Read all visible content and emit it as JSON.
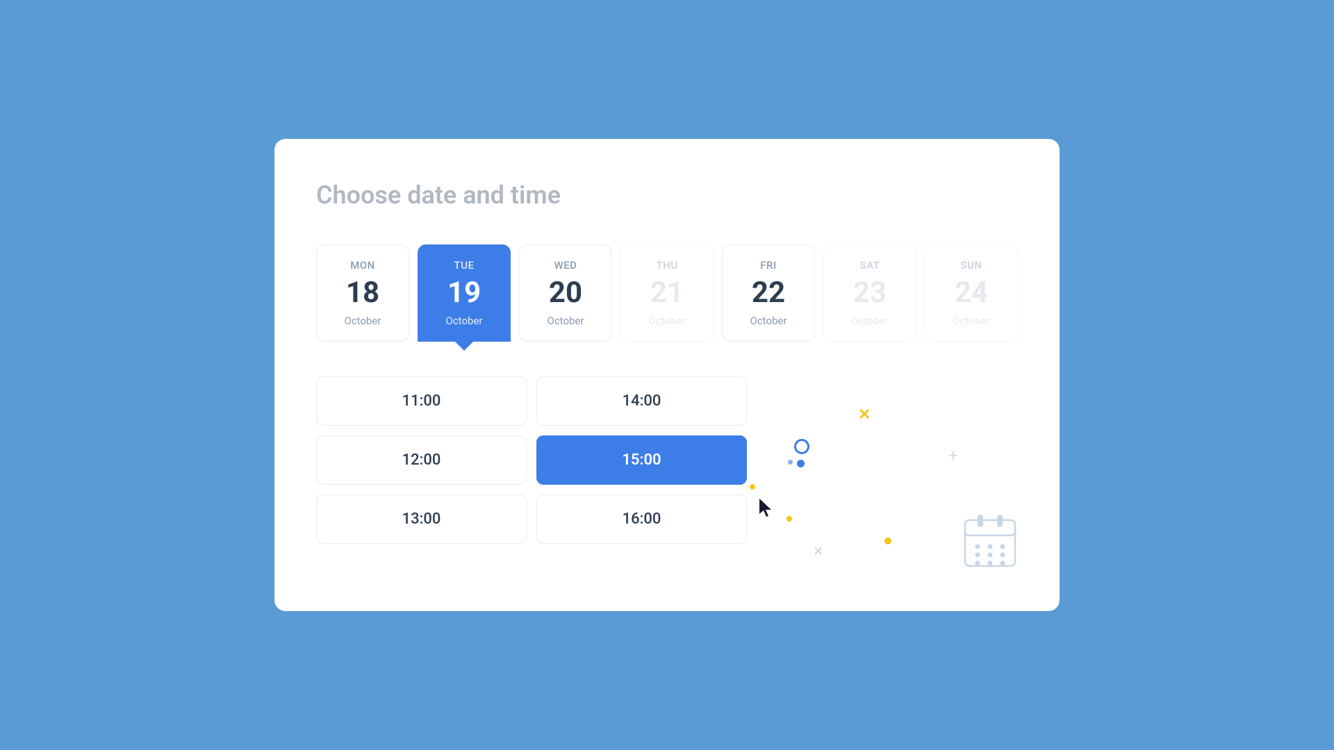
{
  "page": {
    "title": "Choose date and time",
    "background_color": "#5b9bd5"
  },
  "dates": [
    {
      "id": "mon-18",
      "day": "MON",
      "number": "18",
      "month": "October",
      "selected": false,
      "disabled": false
    },
    {
      "id": "tue-19",
      "day": "TUE",
      "number": "19",
      "month": "October",
      "selected": true,
      "disabled": false
    },
    {
      "id": "wed-20",
      "day": "WED",
      "number": "20",
      "month": "October",
      "selected": false,
      "disabled": false
    },
    {
      "id": "thu-21",
      "day": "THU",
      "number": "21",
      "month": "October",
      "selected": false,
      "disabled": true
    },
    {
      "id": "fri-22",
      "day": "FRI",
      "number": "22",
      "month": "October",
      "selected": false,
      "disabled": false
    },
    {
      "id": "sat-23",
      "day": "SAT",
      "number": "23",
      "month": "October",
      "selected": false,
      "disabled": true
    },
    {
      "id": "sun-24",
      "day": "SUN",
      "number": "24",
      "month": "October",
      "selected": false,
      "disabled": true
    }
  ],
  "time_slots": [
    {
      "id": "t1100",
      "time": "11:00",
      "selected": false
    },
    {
      "id": "t1400",
      "time": "14:00",
      "selected": false
    },
    {
      "id": "t1200",
      "time": "12:00",
      "selected": false
    },
    {
      "id": "t1500",
      "time": "15:00",
      "selected": true
    },
    {
      "id": "t1300",
      "time": "13:00",
      "selected": false
    },
    {
      "id": "t1600",
      "time": "16:00",
      "selected": false
    }
  ],
  "colors": {
    "accent_blue": "#3d7de8",
    "disabled_text": "#c8d0da",
    "yellow": "#f5c518"
  }
}
